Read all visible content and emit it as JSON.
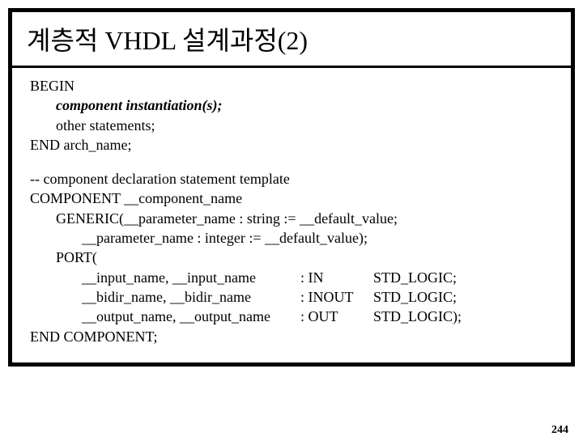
{
  "title": "계층적 VHDL 설계과정(2)",
  "block1": {
    "line1": "BEGIN",
    "line2": "component instantiation(s);",
    "line3": "other statements;",
    "line4": "END arch_name;"
  },
  "block2": {
    "comment": "-- component declaration statement template",
    "comp_line": "COMPONENT __component_name",
    "generic_line1": "GENERIC(__parameter_name : string := __default_value;",
    "generic_line2": "__parameter_name : integer := __default_value);",
    "port_open": "PORT(",
    "port1_names": "__input_name, __input_name",
    "port1_dir": ": IN",
    "port1_type": "STD_LOGIC;",
    "port2_names": "__bidir_name, __bidir_name",
    "port2_dir": ": INOUT",
    "port2_type": "STD_LOGIC;",
    "port3_names": "__output_name, __output_name",
    "port3_dir": ": OUT",
    "port3_type": "STD_LOGIC);",
    "end_comp": "END COMPONENT;"
  },
  "page_number": "244"
}
